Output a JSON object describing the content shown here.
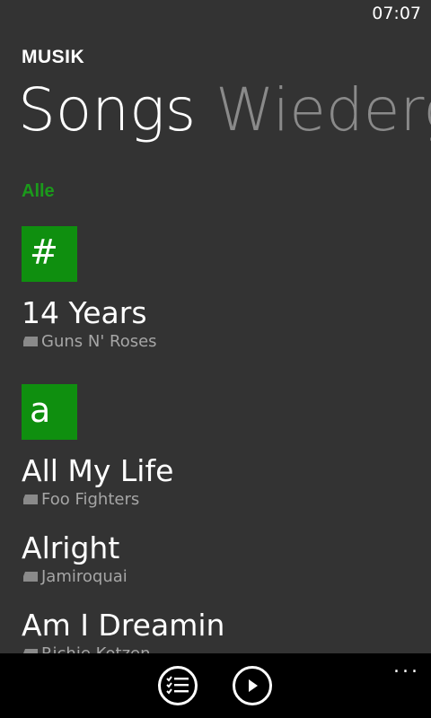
{
  "status_bar": {
    "time": "07:07"
  },
  "app": {
    "title": "MUSIK"
  },
  "pivot": {
    "active": "Songs",
    "next": "Wiederg"
  },
  "filter": {
    "label": "Alle"
  },
  "groups": [
    {
      "letter": "#"
    },
    {
      "letter": "a"
    }
  ],
  "songs": [
    {
      "title": "14 Years",
      "artist": "Guns N' Roses"
    },
    {
      "title": "All My Life",
      "artist": "Foo Fighters"
    },
    {
      "title": "Alright",
      "artist": "Jamiroquai"
    },
    {
      "title": "Am I Dreamin",
      "artist": "Richie Kotzen"
    }
  ],
  "app_bar": {
    "buttons": [
      {
        "icon": "playlist-icon"
      },
      {
        "icon": "play-icon"
      }
    ],
    "more": "..."
  },
  "colors": {
    "accent": "#0f8f0f",
    "background": "#333333",
    "app_bar": "#000000"
  }
}
